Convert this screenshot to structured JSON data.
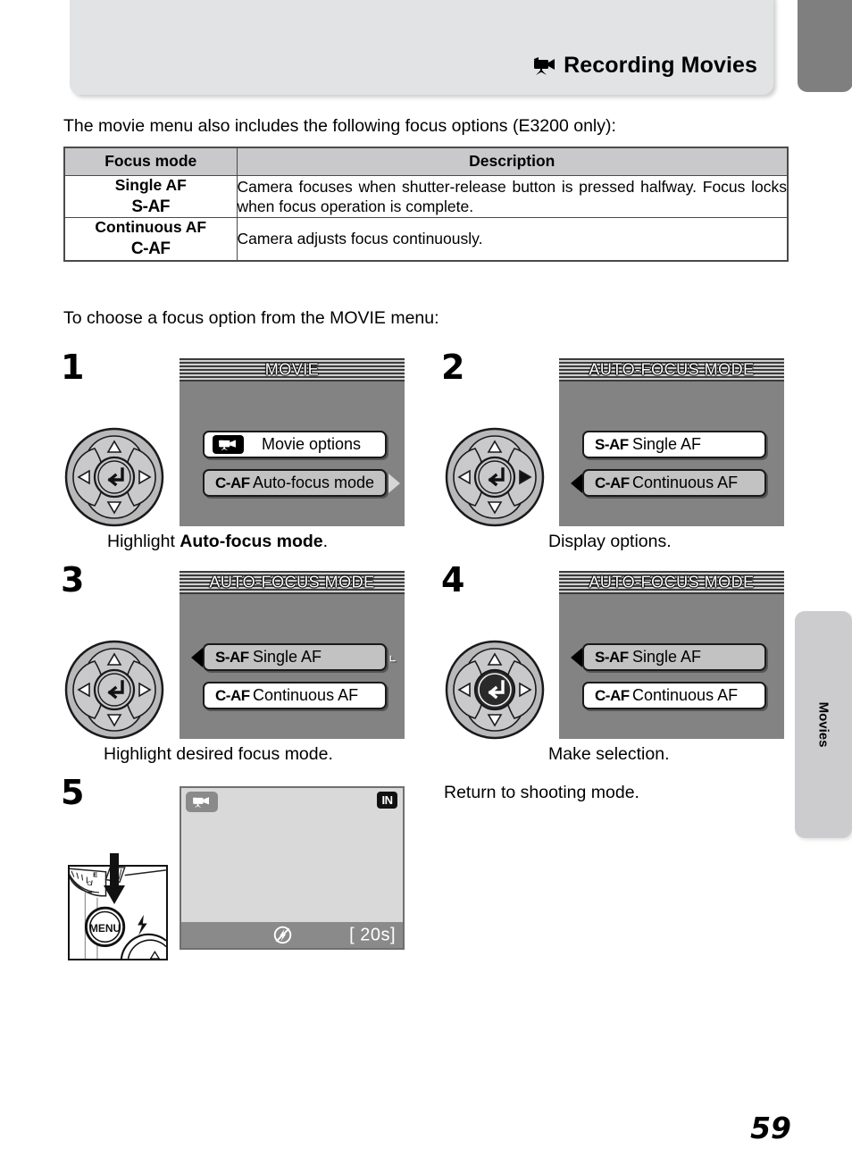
{
  "header": {
    "title": "Recording Movies",
    "icon": "movie-camera-icon"
  },
  "side_tab": {
    "label": "Movies"
  },
  "intro_text": "The movie menu also includes the following focus options (E3200 only):",
  "choose_text": "To choose a focus option from the MOVIE menu:",
  "table": {
    "headers": [
      "Focus mode",
      "Description"
    ],
    "rows": [
      {
        "mode": "Single AF",
        "code": "S-AF",
        "description": "Camera focuses when shutter-release button is pressed halfway. Focus locks when focus operation is complete."
      },
      {
        "mode": "Continuous AF",
        "code": "C-AF",
        "description": "Camera adjusts focus continuously."
      }
    ]
  },
  "steps": [
    {
      "number": "1",
      "screen_title": "MOVIE",
      "rows": [
        {
          "badge": "",
          "label": "Movie options",
          "icon": "movie-options-icon",
          "selected": false
        },
        {
          "badge": "C-AF",
          "label": "Auto-focus mode",
          "icon": "",
          "selected": true
        }
      ],
      "caption_prefix": "Highlight ",
      "caption_bold": "Auto-focus mode",
      "caption_suffix": "."
    },
    {
      "number": "2",
      "screen_title": "AUTO-FOCUS MODE",
      "rows": [
        {
          "badge": "S-AF",
          "label": "Single AF",
          "icon": "",
          "selected": false
        },
        {
          "badge": "C-AF",
          "label": "Continuous AF",
          "icon": "",
          "selected": true
        }
      ],
      "caption_prefix": "Display options.",
      "caption_bold": "",
      "caption_suffix": ""
    },
    {
      "number": "3",
      "screen_title": "AUTO-FOCUS MODE",
      "rows": [
        {
          "badge": "S-AF",
          "label": "Single AF",
          "icon": "",
          "selected": true
        },
        {
          "badge": "C-AF",
          "label": "Continuous AF",
          "icon": "",
          "selected": false
        }
      ],
      "caption_prefix": "Highlight desired focus mode.",
      "caption_bold": "",
      "caption_suffix": ""
    },
    {
      "number": "4",
      "screen_title": "AUTO-FOCUS MODE",
      "rows": [
        {
          "badge": "S-AF",
          "label": "Single AF",
          "icon": "",
          "selected": true
        },
        {
          "badge": "C-AF",
          "label": "Continuous AF",
          "icon": "",
          "selected": false
        }
      ],
      "caption_prefix": "Make selection.",
      "caption_bold": "",
      "caption_suffix": ""
    },
    {
      "number": "5",
      "caption_prefix": "Return to shooting mode.",
      "button_label": "MENU",
      "live_view": {
        "mode_icon": "movie-mode-icon",
        "memory_badge": "IN",
        "flash_icon": "flash-off-icon",
        "time_remaining": "[  20s]"
      }
    }
  ],
  "page_number": "59",
  "colors": {
    "header_band": "#e2e3e5",
    "tab_top": "#7f7f7f",
    "tab_side": "#ccccce",
    "lcd_background": "#838383",
    "lcd_row_selected": "#c2c2c2",
    "table_header": "#c9c9cb"
  }
}
